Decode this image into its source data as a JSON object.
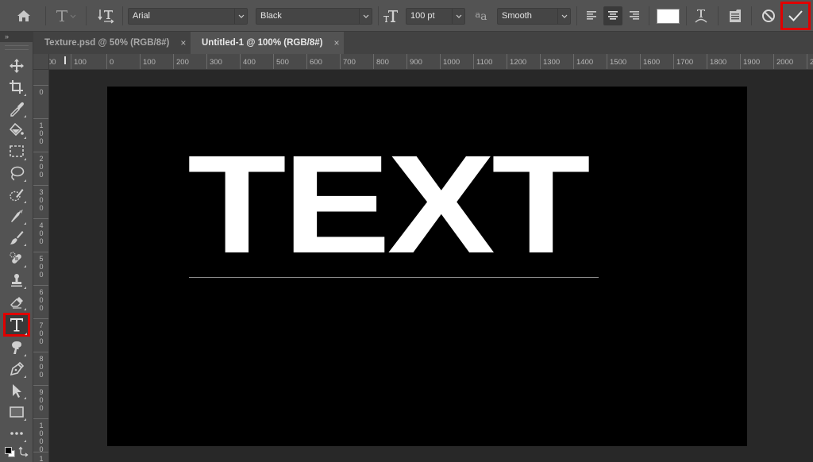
{
  "options_bar": {
    "home_icon": "home-icon",
    "tool_preset_icon": "type-tool-preset-icon",
    "orientation_icon": "toggle-text-orientation-icon",
    "font_family": "Arial",
    "font_style": "Black",
    "font_size_icon": "font-size-icon",
    "font_size": "100 pt",
    "antialias_icon": "antialias-icon",
    "antialias_glyph": "aa",
    "antialias": "Smooth",
    "align_left_icon": "align-left-icon",
    "align_center_icon": "align-center-icon",
    "align_right_icon": "align-right-icon",
    "active_alignment": "center",
    "text_color": "#ffffff",
    "warp_icon": "warp-text-icon",
    "panels_icon": "character-paragraph-panels-icon",
    "cancel_icon": "cancel-icon",
    "commit_icon": "commit-checkmark-icon"
  },
  "panel_collapse_label": "»",
  "tabs": [
    {
      "label": "Texture.psd @ 50% (RGB/8#)",
      "close": "×",
      "active": false
    },
    {
      "label": "Untitled-1 @ 100% (RGB/8#)",
      "close": "×",
      "active": true
    }
  ],
  "toolbar": {
    "tools": [
      {
        "name": "move-tool",
        "icon": "move-icon"
      },
      {
        "name": "crop-tool",
        "icon": "crop-icon"
      },
      {
        "name": "eyedropper-tool",
        "icon": "eyedropper-icon"
      },
      {
        "name": "paint-bucket-tool",
        "icon": "paint-bucket-icon"
      },
      {
        "name": "rectangular-marquee-tool",
        "icon": "marquee-icon"
      },
      {
        "name": "lasso-tool",
        "icon": "lasso-icon"
      },
      {
        "name": "quick-selection-tool",
        "icon": "quick-selection-icon"
      },
      {
        "name": "healing-brush-tool",
        "icon": "spot-healing-icon"
      },
      {
        "name": "brush-tool",
        "icon": "brush-icon"
      },
      {
        "name": "clone-stamp-tool",
        "icon": "healing-bandage-icon"
      },
      {
        "name": "stamp-tool",
        "icon": "stamp-icon"
      },
      {
        "name": "eraser-tool",
        "icon": "eraser-icon"
      },
      {
        "name": "type-tool",
        "icon": "type-icon",
        "selected": true
      },
      {
        "name": "smudge-tool",
        "icon": "smudge-icon"
      },
      {
        "name": "pen-tool",
        "icon": "pen-icon"
      },
      {
        "name": "path-selection-tool",
        "icon": "arrow-icon"
      },
      {
        "name": "rectangle-tool",
        "icon": "rectangle-icon"
      },
      {
        "name": "edit-toolbar",
        "icon": "more-icon"
      }
    ],
    "foreground_color": "#000000",
    "background_color": "#ffffff"
  },
  "rulers": {
    "horizontal_labels": [
      "00",
      "100",
      "0",
      "100",
      "200",
      "300",
      "400",
      "500",
      "600",
      "700",
      "800",
      "900",
      "1000",
      "1100",
      "1200",
      "1300",
      "1400",
      "1500",
      "1600",
      "1700",
      "1800",
      "1900",
      "2000",
      "2"
    ],
    "vertical_labels": [
      "0",
      "100",
      "200",
      "300",
      "400",
      "500",
      "600",
      "700",
      "800",
      "900",
      "1000",
      "1"
    ]
  },
  "canvas": {
    "text": "TEXT",
    "text_color": "#ffffff",
    "background_color": "#000000"
  },
  "highlight_color": "#e00000"
}
